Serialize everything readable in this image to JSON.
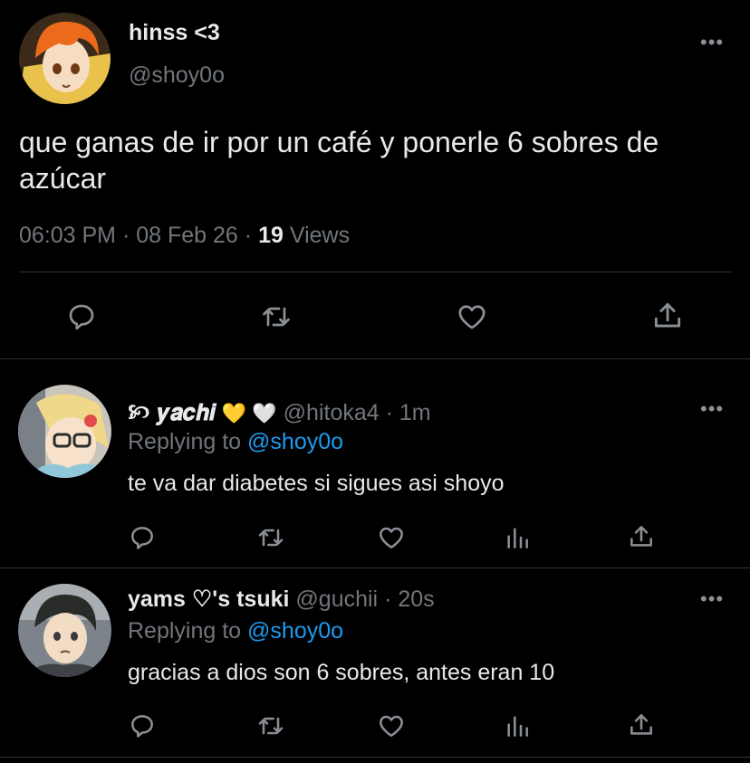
{
  "main_tweet": {
    "display_name": "hinss <3",
    "handle": "@shoy0o",
    "text": "que ganas de ir por un café y ponerle 6 sobres de azúcar",
    "time": "06:03 PM",
    "date": "08 Feb 26",
    "sep": "·",
    "views_count": "19",
    "views_label": "Views"
  },
  "replies": [
    {
      "display_name": "🙡 𝒚𝒂𝒄𝒉𝒊",
      "emojis": "💛 🤍",
      "handle": "@hitoka4",
      "time": "1m",
      "replying_prefix": "Replying to",
      "replying_to": "@shoy0o",
      "text": "te va dar diabetes si sigues asi shoyo"
    },
    {
      "display_name": "yams ♡'s tsuki",
      "handle": "@guchii",
      "time": "20s",
      "replying_prefix": "Replying to",
      "replying_to": "@shoy0o",
      "text": "gracias a dios son 6 sobres, antes eran 10"
    }
  ],
  "icons": {
    "more": "more-icon",
    "reply": "reply-icon",
    "retweet": "retweet-icon",
    "like": "heart-icon",
    "share": "share-icon",
    "analytics": "analytics-icon"
  },
  "colors": {
    "background": "#000000",
    "text": "#e7e9ea",
    "muted": "#71767b",
    "link": "#1d9bf0",
    "divider": "#2f3336"
  }
}
